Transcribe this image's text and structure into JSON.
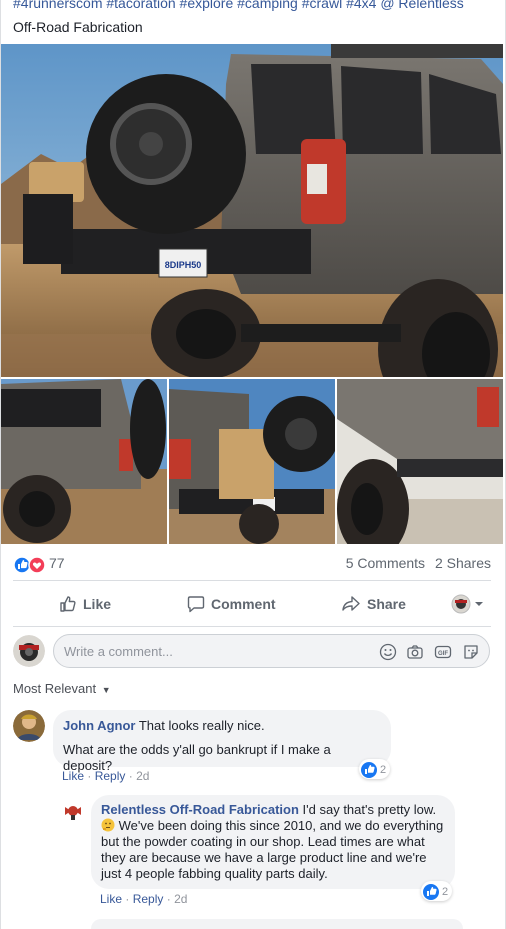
{
  "post": {
    "caption_tags": "#4runnerscom #tacoration #explore #camping #crawl #4x4",
    "caption_mention": "@ Relentless",
    "caption_line2": "Off-Road Fabrication"
  },
  "stats": {
    "reaction_count": "77",
    "comments": "5 Comments",
    "shares": "2 Shares"
  },
  "actions": {
    "like": "Like",
    "comment": "Comment",
    "share": "Share"
  },
  "composer": {
    "placeholder": "Write a comment..."
  },
  "sort": {
    "label": "Most Relevant"
  },
  "comments": [
    {
      "author": "John Agnor",
      "line1": "That looks really nice.",
      "line2": "What are the odds y'all go bankrupt if I make a deposit?",
      "like": "Like",
      "reply": "Reply",
      "time": "2d",
      "reactions": "2"
    }
  ],
  "replies": [
    {
      "author": "Relentless Off-Road Fabrication",
      "text_start": "I'd say that's pretty low.",
      "text_rest": "We've been doing this since 2010, and we do everything but the powder coating in our shop. Lead times are what they are because we have a large product line and we're just 4 people fabbing quality parts daily.",
      "like": "Like",
      "reply": "Reply",
      "time": "2d",
      "reactions": "2"
    }
  ],
  "photo": {
    "plate": "8DIPH50"
  },
  "colors": {
    "link": "#385898",
    "like_blue": "#1877f2",
    "love_red": "#f33e58",
    "bubble": "#f2f3f5"
  }
}
